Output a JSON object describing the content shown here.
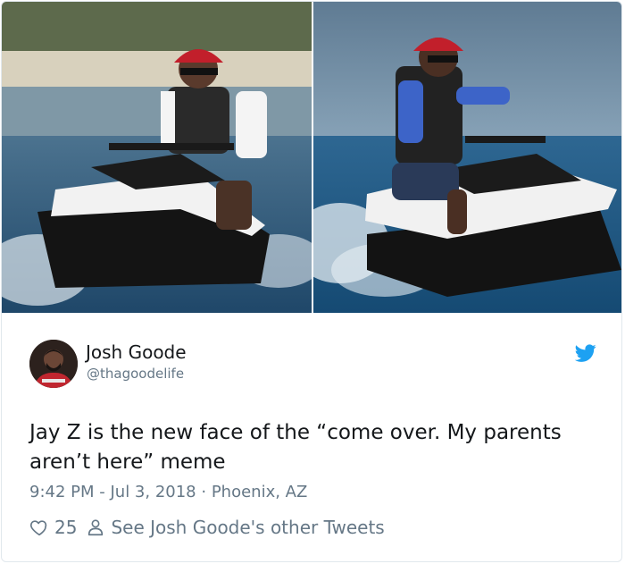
{
  "tweet": {
    "author_name": "Josh Goode",
    "author_handle": "@thagoodelife",
    "text": "Jay Z is the new face of the “come over. My parents aren’t here” meme",
    "time": "9:42 PM",
    "date": "Jul 3, 2018",
    "location": "Phoenix, AZ",
    "meta_separator_1": " - ",
    "meta_separator_2": " · ",
    "like_count": "25",
    "other_tweets_label": "See Josh Goode's other Tweets"
  },
  "icons": {
    "brand": "twitter-bird-icon",
    "like": "heart-icon",
    "profile": "person-icon"
  },
  "colors": {
    "twitter_blue": "#1da1f2",
    "text_primary": "#14171a",
    "text_secondary": "#657786",
    "card_border": "#e1e8ed"
  }
}
